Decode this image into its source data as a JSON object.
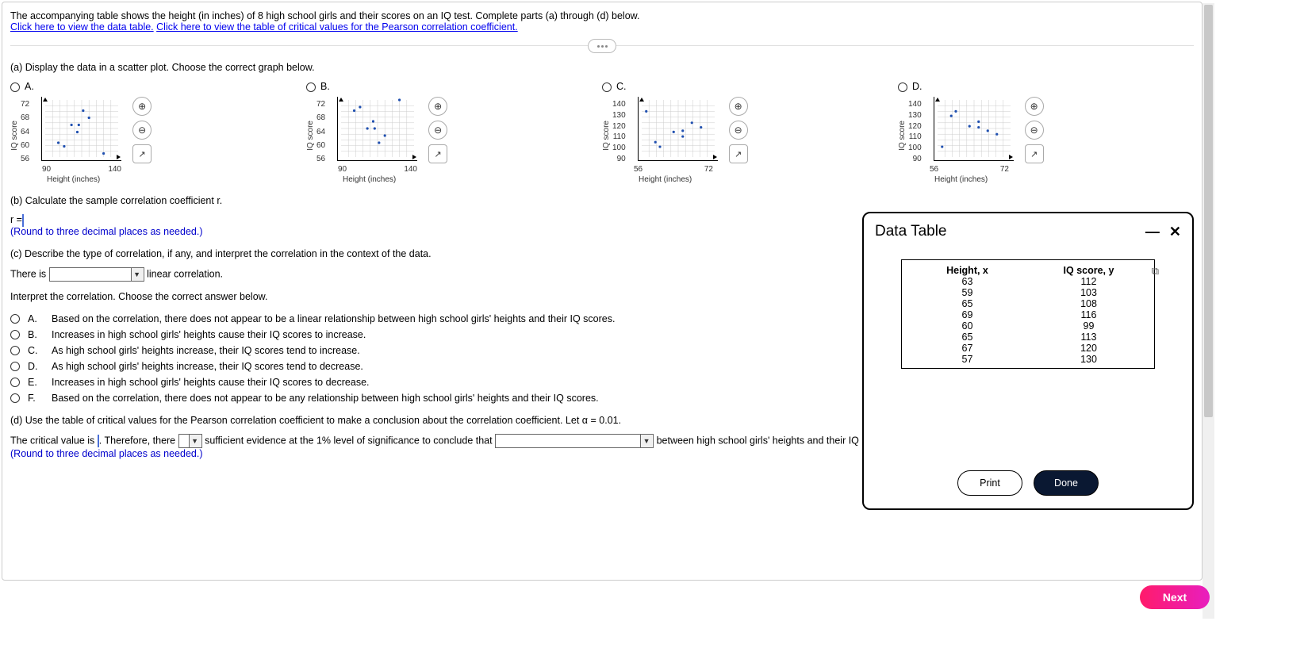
{
  "intro": "The accompanying table shows the height (in inches) of 8 high school girls and their scores on an IQ test. Complete parts (a) through (d) below.",
  "link1": "Click here to view the data table.",
  "link2": "Click here to view the table of critical values for the Pearson correlation coefficient.",
  "part_a": {
    "prompt": "(a) Display the data in a scatter plot. Choose the correct graph below.",
    "options": [
      "A.",
      "B.",
      "C.",
      "D."
    ]
  },
  "chart_data": [
    {
      "type": "scatter",
      "option": "A",
      "xlabel": "Height (inches)",
      "ylabel": "IQ score",
      "xlim": [
        90,
        140
      ],
      "ylim": [
        56,
        72
      ],
      "xticks": [
        90,
        140
      ],
      "yticks": [
        56,
        60,
        64,
        68,
        72
      ],
      "points": [
        {
          "x": 112,
          "y": 63
        },
        {
          "x": 103,
          "y": 59
        },
        {
          "x": 108,
          "y": 65
        },
        {
          "x": 116,
          "y": 69
        },
        {
          "x": 99,
          "y": 60
        },
        {
          "x": 113,
          "y": 65
        },
        {
          "x": 120,
          "y": 67
        },
        {
          "x": 130,
          "y": 57
        }
      ]
    },
    {
      "type": "scatter",
      "option": "B",
      "xlabel": "Height (inches)",
      "ylabel": "IQ score",
      "xlim": [
        90,
        140
      ],
      "ylim": [
        56,
        72
      ],
      "xticks": [
        90,
        140
      ],
      "yticks": [
        56,
        60,
        64,
        68,
        72
      ],
      "points": [
        {
          "x": 99,
          "y": 69
        },
        {
          "x": 103,
          "y": 70
        },
        {
          "x": 108,
          "y": 64
        },
        {
          "x": 112,
          "y": 66
        },
        {
          "x": 113,
          "y": 64
        },
        {
          "x": 116,
          "y": 60
        },
        {
          "x": 120,
          "y": 62
        },
        {
          "x": 130,
          "y": 72
        }
      ]
    },
    {
      "type": "scatter",
      "option": "C",
      "xlabel": "Height (inches)",
      "ylabel": "IQ score",
      "xlim": [
        56,
        72
      ],
      "ylim": [
        90,
        140
      ],
      "xticks": [
        56,
        72
      ],
      "yticks": [
        90,
        100,
        110,
        120,
        130,
        140
      ],
      "points": [
        {
          "x": 63,
          "y": 112
        },
        {
          "x": 59,
          "y": 103
        },
        {
          "x": 65,
          "y": 108
        },
        {
          "x": 69,
          "y": 116
        },
        {
          "x": 60,
          "y": 99
        },
        {
          "x": 65,
          "y": 113
        },
        {
          "x": 67,
          "y": 120
        },
        {
          "x": 57,
          "y": 130
        }
      ]
    },
    {
      "type": "scatter",
      "option": "D",
      "xlabel": "Height (inches)",
      "ylabel": "IQ score",
      "xlim": [
        56,
        72
      ],
      "ylim": [
        90,
        140
      ],
      "xticks": [
        56,
        72
      ],
      "yticks": [
        90,
        100,
        110,
        120,
        130,
        140
      ],
      "points": [
        {
          "x": 57,
          "y": 99
        },
        {
          "x": 59,
          "y": 126
        },
        {
          "x": 60,
          "y": 130
        },
        {
          "x": 63,
          "y": 117
        },
        {
          "x": 65,
          "y": 121
        },
        {
          "x": 65,
          "y": 116
        },
        {
          "x": 67,
          "y": 113
        },
        {
          "x": 69,
          "y": 110
        }
      ]
    }
  ],
  "part_b": {
    "prompt": "(b) Calculate the sample correlation coefficient r.",
    "r_label": "r =",
    "note": "(Round to three decimal places as needed.)"
  },
  "part_c": {
    "prompt": "(c) Describe the type of correlation, if any, and interpret the correlation in the context of the data.",
    "sentence_pre": "There is",
    "sentence_post": "linear correlation.",
    "interpret_prompt": "Interpret the correlation. Choose the correct answer below.",
    "choices": [
      {
        "label": "A.",
        "text": "Based on the correlation, there does not appear to be a linear relationship between high school girls' heights and their IQ scores."
      },
      {
        "label": "B.",
        "text": "Increases in high school girls' heights cause their IQ scores to increase."
      },
      {
        "label": "C.",
        "text": "As high school girls' heights increase, their IQ scores tend to increase."
      },
      {
        "label": "D.",
        "text": "As high school girls' heights increase, their IQ scores tend to decrease."
      },
      {
        "label": "E.",
        "text": "Increases in high school girls' heights cause their IQ scores to decrease."
      },
      {
        "label": "F.",
        "text": "Based on the correlation, there does not appear to be any relationship between high school girls' heights and their IQ scores."
      }
    ]
  },
  "part_d": {
    "prompt": "(d) Use the table of critical values for the Pearson correlation coefficient to make a conclusion about the correlation coefficient. Let α = 0.01.",
    "s1": "The critical value is",
    "s2": ". Therefore, there",
    "s3": "sufficient evidence at the 1% level of significance to conclude that",
    "s4": "between high school girls' heights and their IQ scores.",
    "note": "(Round to three decimal places as needed.)"
  },
  "dialog": {
    "title": "Data Table",
    "headers": [
      "Height, x",
      "IQ score, y"
    ],
    "rows": [
      [
        63,
        112
      ],
      [
        59,
        103
      ],
      [
        65,
        108
      ],
      [
        69,
        116
      ],
      [
        60,
        99
      ],
      [
        65,
        113
      ],
      [
        67,
        120
      ],
      [
        57,
        130
      ]
    ],
    "print": "Print",
    "done": "Done"
  },
  "next": "Next"
}
